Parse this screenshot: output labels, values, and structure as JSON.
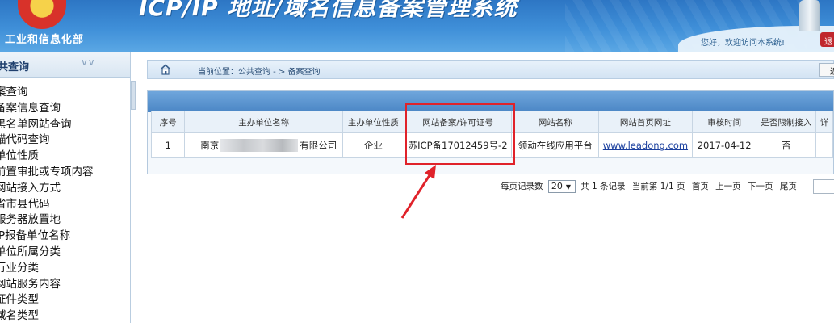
{
  "header": {
    "ministry": "工业和信息化部",
    "system_title": "ICP/IP 地址/域名信息备案管理系统",
    "welcome": "您好，欢迎访问本系统!",
    "logout": "退"
  },
  "sidebar": {
    "title": "共查询",
    "items": [
      {
        "label": "案查询"
      },
      {
        "label": "备案信息查询"
      },
      {
        "label": "黑名单网站查询"
      },
      {
        "label": "锚代码查询"
      },
      {
        "label": "单位性质"
      },
      {
        "label": "前置审批或专项内容"
      },
      {
        "label": "网站接入方式"
      },
      {
        "label": "省市县代码"
      },
      {
        "label": "服务器放置地"
      },
      {
        "label": "IP报备单位名称"
      },
      {
        "label": "单位所属分类"
      },
      {
        "label": "行业分类"
      },
      {
        "label": "网站服务内容"
      },
      {
        "label": "证件类型"
      },
      {
        "label": "域名类型"
      }
    ]
  },
  "breadcrumb": {
    "text": "当前位置：公共查询  - >  备案查询",
    "back_label": "返"
  },
  "table": {
    "headers": [
      "序号",
      "主办单位名称",
      "主办单位性质",
      "网站备案/许可证号",
      "网站名称",
      "网站首页网址",
      "审核时间",
      "是否限制接入",
      "详"
    ],
    "row": {
      "index": "1",
      "org_prefix": "南京",
      "org_suffix": "有限公司",
      "org_type": "企业",
      "license": "苏ICP备17012459号-2",
      "site_name": "领动在线应用平台",
      "site_url": "www.leadong.com",
      "review_date": "2017-04-12",
      "restricted": "否"
    }
  },
  "pager": {
    "per_page_label": "每页记录数",
    "per_page_value": "20",
    "total": "共 1 条记录",
    "current": "当前第 1/1 页",
    "first": "首页",
    "prev": "上一页",
    "next": "下一页",
    "last": "尾页"
  },
  "colors": {
    "header_blue": "#3f8fd8",
    "annotation_red": "#e0222a",
    "link_blue": "#1a3f9e"
  }
}
